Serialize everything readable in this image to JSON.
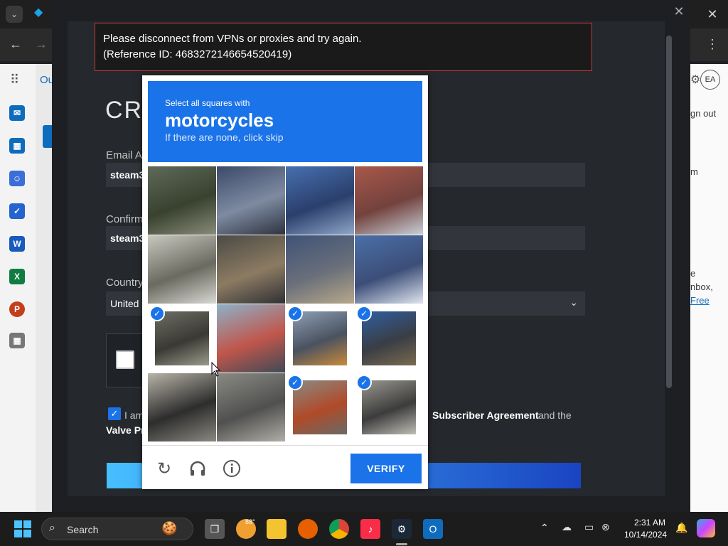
{
  "browser": {
    "close_tab": "✕",
    "menu": "⋮"
  },
  "outlook": {
    "account_initials": "EA",
    "sign_out": "gn out",
    "right_text_1": "m",
    "right_text_2": "e",
    "right_text_3": "nbox,",
    "right_link": "Free",
    "left_text": "Ou"
  },
  "steam": {
    "error_line1": "Please disconnect from VPNs or proxies and try again.",
    "error_line2": "(Reference ID: 4683272146654520419)",
    "title": "CRI",
    "email_label": "Email A",
    "email_value": "steam3",
    "confirm_label": "Confirm",
    "confirm_value": "steam3",
    "country_label": "Country",
    "country_value": "United",
    "agree_prefix": "I am",
    "agree_bold": "Subscriber Agreement",
    "agree_suffix": "and the",
    "valve_text": "Valve Pr"
  },
  "captcha": {
    "instruction": "Select all squares with",
    "target": "motorcycles",
    "hint": "If there are none, click skip",
    "verify_label": "VERIFY",
    "tiles": [
      {
        "selected": false
      },
      {
        "selected": false
      },
      {
        "selected": false
      },
      {
        "selected": false
      },
      {
        "selected": false
      },
      {
        "selected": false
      },
      {
        "selected": false
      },
      {
        "selected": false
      },
      {
        "selected": true
      },
      {
        "selected": false
      },
      {
        "selected": true
      },
      {
        "selected": true
      },
      {
        "selected": false
      },
      {
        "selected": false
      },
      {
        "selected": true
      },
      {
        "selected": true
      }
    ]
  },
  "taskbar": {
    "search_placeholder": "Search",
    "temperature": "88°",
    "time": "2:31 AM",
    "date": "10/14/2024"
  },
  "colors": {
    "captcha_blue": "#1a73e8",
    "error_border": "#c23b3b"
  }
}
